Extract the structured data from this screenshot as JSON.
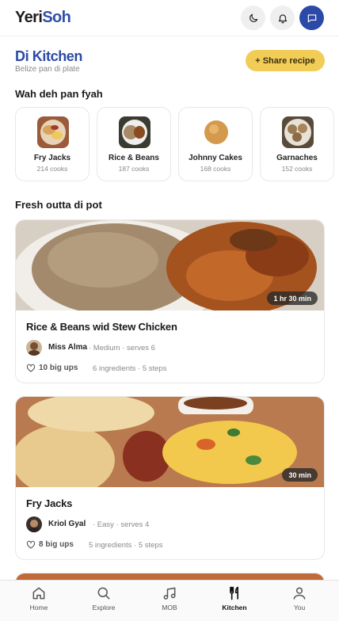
{
  "app": {
    "logo_part1": "Yeri",
    "logo_part2": "Soh"
  },
  "header": {
    "icons": [
      "moon-icon",
      "bell-icon",
      "chat-icon"
    ],
    "accent": "#2b4aa7"
  },
  "kitchen": {
    "title": "Di Kitchen",
    "subtitle": "Belize pan di plate",
    "share_label": "+ Share recipe",
    "share_color": "#f1cd58"
  },
  "trending": {
    "heading": "Wah deh pan fyah",
    "categories": [
      {
        "name": "Fry Jacks",
        "count": "214 cooks"
      },
      {
        "name": "Rice & Beans",
        "count": "187 cooks"
      },
      {
        "name": "Johnny Cakes",
        "count": "168 cooks"
      },
      {
        "name": "Garnaches",
        "count": "152 cooks"
      }
    ]
  },
  "fresh": {
    "heading": "Fresh outta di pot",
    "recipes": [
      {
        "title": "Rice & Beans wid Stew Chicken",
        "time": "1 hr 30 min",
        "author": "Miss Alma",
        "meta": "· Medium · serves 6",
        "likes": "10 big ups",
        "stats": "6 ingredients · 5 steps"
      },
      {
        "title": "Fry Jacks",
        "time": "30 min",
        "author": "Kriol Gyal",
        "meta": "· Easy · serves 4",
        "likes": "8 big ups",
        "stats": "5 ingredients · 5 steps"
      }
    ]
  },
  "nav": {
    "items": [
      {
        "label": "Home",
        "icon": "home-icon"
      },
      {
        "label": "Explore",
        "icon": "search-icon"
      },
      {
        "label": "MOB",
        "icon": "music-icon"
      },
      {
        "label": "Kitchen",
        "icon": "utensils-icon"
      },
      {
        "label": "You",
        "icon": "user-icon"
      }
    ],
    "active": "Kitchen"
  }
}
